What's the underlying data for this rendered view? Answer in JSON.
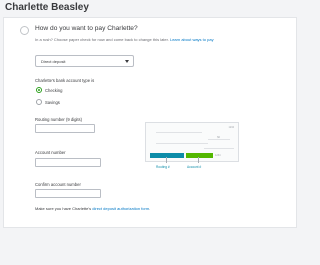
{
  "header": {
    "employee_name": "Charlette Beasley"
  },
  "payment": {
    "question": "How do you want to pay Charlette?",
    "helper_text": "In a rush? Choose paper check for now and come back to change this later.",
    "helper_link": "Learn about ways to pay",
    "method_selected": "Direct deposit",
    "account_type_label": "Charlette's bank account type is",
    "account_types": [
      {
        "label": "Checking",
        "selected": true
      },
      {
        "label": "Savings",
        "selected": false
      }
    ],
    "routing_label": "Routing number (9 digits)",
    "routing_value": "",
    "account_label": "Account number",
    "account_value": "",
    "confirm_label": "Confirm account number",
    "confirm_value": ""
  },
  "check_illustration": {
    "check_number_text": "1234",
    "amount_text": "$0",
    "routing_box_text": "",
    "account_box_text": "",
    "check_number_bottom": "1234",
    "routing_caption": "Routing #",
    "account_caption": "Account #"
  },
  "footer": {
    "note_prefix": "Make sure you have Charlette's",
    "note_link": "direct deposit authorization form",
    "note_suffix": "."
  },
  "colors": {
    "accent_green": "#2ca01c",
    "routing_teal": "#0d8ca8",
    "account_green": "#53b700",
    "link_blue": "#0077c5"
  }
}
